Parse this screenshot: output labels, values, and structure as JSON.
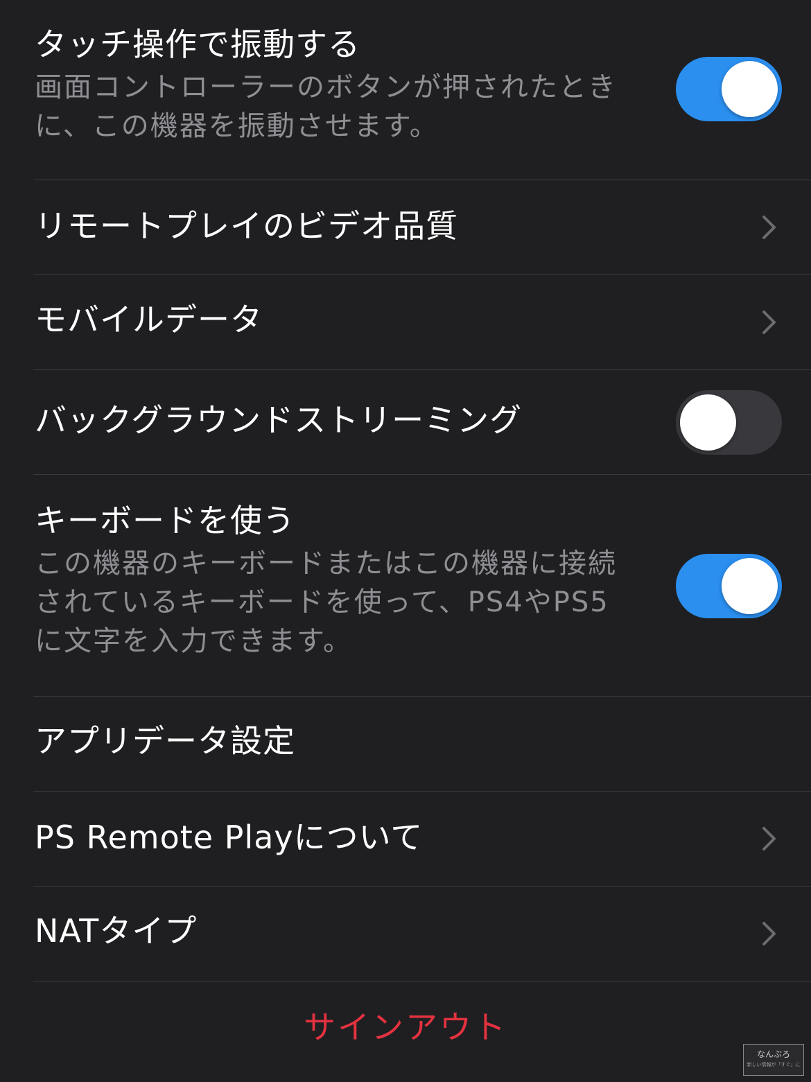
{
  "settings": {
    "haptic": {
      "title": "タッチ操作で振動する",
      "description": "画面コントローラーのボタンが押されたときに、この機器を振動させます。",
      "toggle_state": "on"
    },
    "video_quality": {
      "title": "リモートプレイのビデオ品質"
    },
    "mobile_data": {
      "title": "モバイルデータ"
    },
    "background_streaming": {
      "title": "バックグラウンドストリーミング",
      "toggle_state": "off"
    },
    "keyboard": {
      "title": "キーボードを使う",
      "description": "この機器のキーボードまたはこの機器に接続されているキーボードを使って、PS4やPS5に文字を入力できます。",
      "toggle_state": "on"
    },
    "app_data": {
      "title": "アプリデータ設定"
    },
    "about": {
      "title": "PS Remote Playについて"
    },
    "nat_type": {
      "title": "NATタイプ"
    }
  },
  "signout": {
    "label": "サインアウト"
  },
  "watermark": {
    "main": "なんぶろ",
    "sub": "新しい情報が「すぐ」に"
  },
  "colors": {
    "background": "#1f1f22",
    "toggle_on": "#2b8ff0",
    "toggle_off": "#39393d",
    "signout": "#e5323f",
    "secondary_text": "#8e8e93"
  },
  "icons": {
    "chevron": "chevron-right-icon"
  }
}
